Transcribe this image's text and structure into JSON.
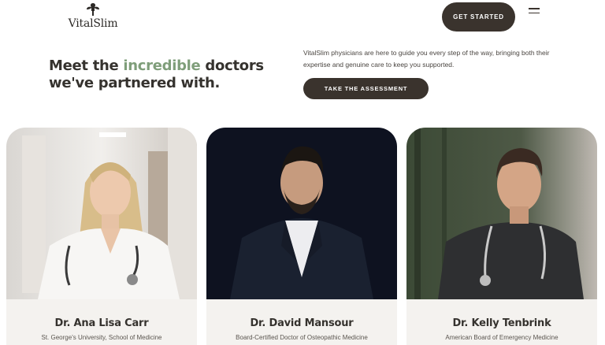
{
  "brand": {
    "name": "VitalSlim",
    "logo_icon": "leaf-cross-icon"
  },
  "header": {
    "cta_label": "GET STARTED",
    "menu_icon": "hamburger-menu-icon"
  },
  "hero": {
    "headline_part1": "Meet the ",
    "headline_accent": "incredible",
    "headline_part2": " doctors",
    "headline_line2": "we've partnered with.",
    "intro": "VitalSlim physicians are here to guide you every step of the way, bringing both their expertise and genuine care to keep you supported.",
    "assessment_label": "TAKE THE ASSESSMENT"
  },
  "colors": {
    "accent": "#7f9e7a",
    "button": "#3a332d",
    "caption_bg": "#f4f2ef"
  },
  "doctors": [
    {
      "name": "Dr. Ana Lisa Carr",
      "credential": "St. George's University, School of Medicine"
    },
    {
      "name": "Dr. David Mansour",
      "credential": "Board-Certified Doctor of Osteopathic Medicine"
    },
    {
      "name": "Dr. Kelly Tenbrink",
      "credential": "American Board of Emergency Medicine"
    }
  ]
}
